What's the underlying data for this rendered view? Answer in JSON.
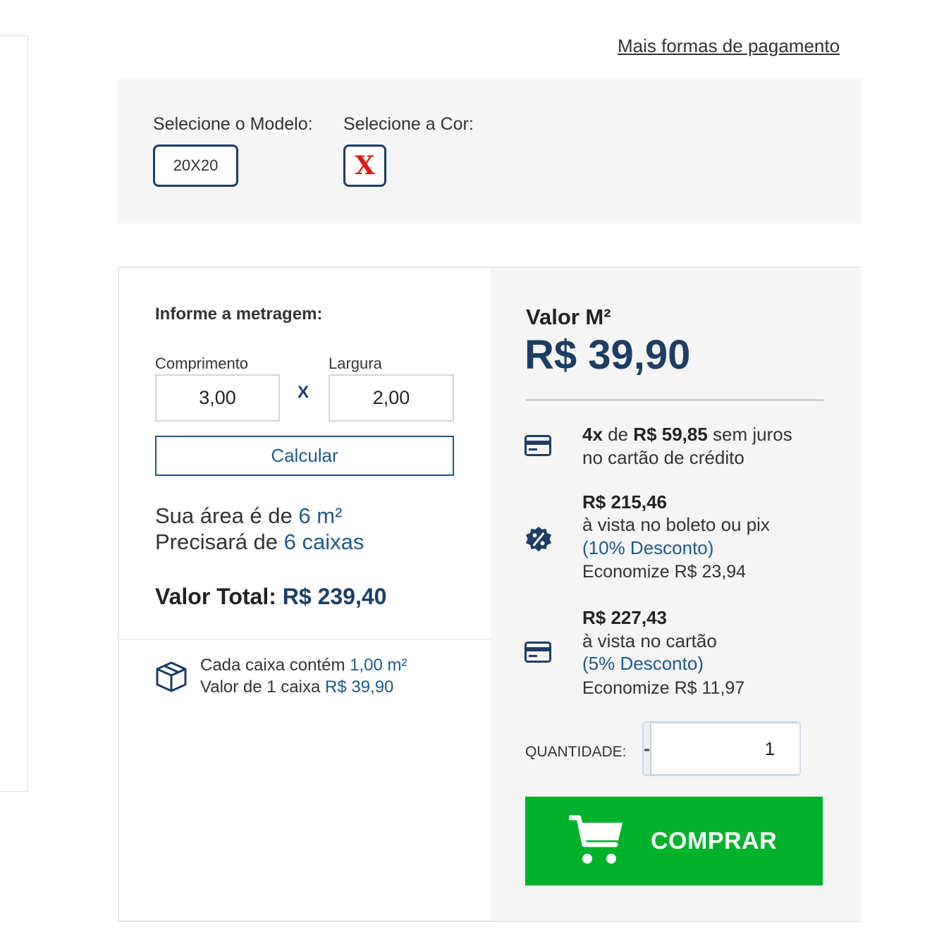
{
  "header": {
    "more_payment_link": "Mais formas de pagamento"
  },
  "variations": {
    "model_label": "Selecione o Modelo:",
    "model_value": "20X20",
    "color_label": "Selecione a Cor:",
    "color_value_icon": "x-unavailable-icon"
  },
  "calculator": {
    "title": "Informe a metragem:",
    "length_label": "Comprimento",
    "length_value": "3,00",
    "times_symbol": "X",
    "width_label": "Largura",
    "width_value": "2,00",
    "calc_button": "Calcular",
    "area_prefix": "Sua área é de ",
    "area_value": "6 m²",
    "boxes_prefix": "Precisará de ",
    "boxes_value": "6 caixas",
    "total_label": "Valor Total: ",
    "total_value": "R$ 239,40",
    "box_info": {
      "icon": "box-icon",
      "line1_prefix": "Cada caixa contém ",
      "line1_value": "1,00 m²",
      "line2_prefix": "Valor de 1 caixa ",
      "line2_value": "R$ 39,90"
    }
  },
  "pricing": {
    "unit_label": "Valor M²",
    "unit_price": "R$ 39,90",
    "installments": {
      "icon": "credit-card-icon",
      "count": "4x",
      "de": " de ",
      "amount": "R$ 59,85",
      "suffix": " sem juros",
      "line2": "no cartão de crédito"
    },
    "boleto": {
      "icon": "percent-badge-icon",
      "price": "R$ 215,46",
      "line2": "à vista no boleto ou pix",
      "discount": "(10% Desconto)",
      "savings": "Economize R$ 23,94"
    },
    "card_cash": {
      "icon": "credit-card-icon",
      "price": "R$ 227,43",
      "line2": "à vista no cartão",
      "discount": "(5% Desconto)",
      "savings": "Economize R$ 11,97"
    },
    "quantity": {
      "label": "QUANTIDADE:",
      "minus": "-",
      "value": "1",
      "plus": "+"
    },
    "buy_button": "COMPRAR"
  },
  "colors": {
    "brand_navy": "#1c3e66",
    "link_blue": "#1c5a8c",
    "buy_green": "#02b22c",
    "panel_gray": "#f5f5f5"
  }
}
